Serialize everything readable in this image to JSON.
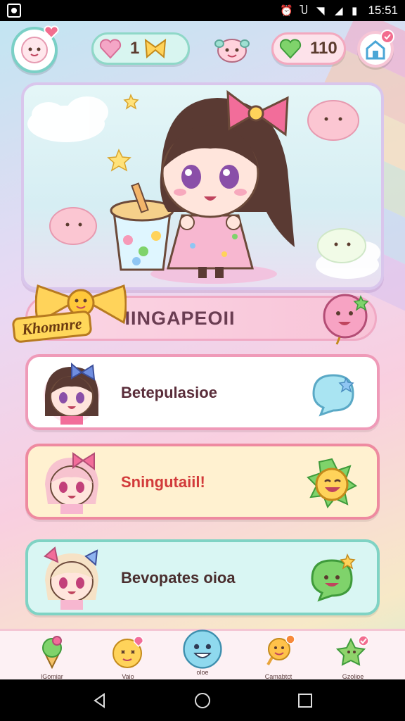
{
  "status_bar": {
    "time": "15:51"
  },
  "top_bar": {
    "hearts_pink": "1",
    "hearts_green": "110"
  },
  "hero": {
    "character": "chibi-girl-with-bubble-tea"
  },
  "banner": {
    "title": "IINGAPEOII",
    "corner_tag": "Khomnre"
  },
  "cards": [
    {
      "label": "Betepulasioe",
      "color": "#ffffff",
      "border": "#ef9ab8",
      "text_color": "#5a2d3a"
    },
    {
      "label": "Sningutaiil!",
      "color": "#fff1d0",
      "border": "#ee8aa0",
      "text_color": "#d23a3a"
    },
    {
      "label": "Bevopates oioa",
      "color": "#d9f6f3",
      "border": "#7fd3c4",
      "text_color": "#4a2e2e"
    }
  ],
  "bottom_nav": [
    {
      "label": "lGomiar",
      "icon": "ice-cream-icon"
    },
    {
      "label": "Vaio",
      "icon": "star-face-icon"
    },
    {
      "label": "oloe",
      "icon": "blue-bubble-icon"
    },
    {
      "label": "Camabtct",
      "icon": "smile-sparkle-icon"
    },
    {
      "label": "Gzolioe",
      "icon": "green-star-icon"
    }
  ],
  "colors": {
    "accent_pink": "#f28bb4",
    "accent_teal": "#7ad0c6",
    "accent_yellow": "#ffd75a"
  }
}
